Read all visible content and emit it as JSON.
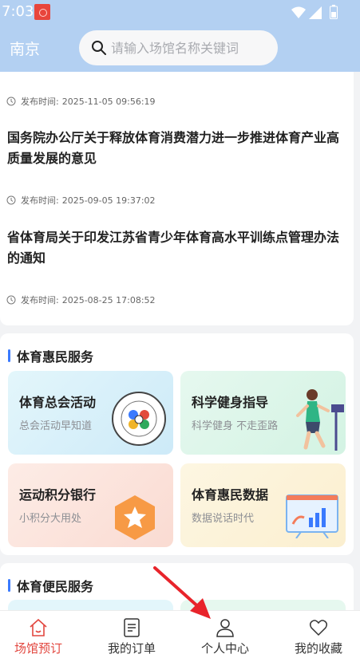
{
  "status": {
    "time": "7:03"
  },
  "header": {
    "city": "南京",
    "search_placeholder": "请输入场馆名称关键词"
  },
  "news": {
    "meta_label": "发布时间:",
    "items": [
      {
        "title": "",
        "time": "2025-11-05 09:56:19"
      },
      {
        "title": "国务院办公厅关于释放体育消费潜力进一步推进体育产业高质量发展的意见",
        "time": "2025-09-05 19:37:02"
      },
      {
        "title": "省体育局关于印发江苏省青少年体育高水平训练点管理办法的通知",
        "time": "2025-08-25 17:08:52"
      }
    ]
  },
  "services": {
    "title": "体育惠民服务",
    "items": [
      {
        "title": "体育总会活动",
        "subtitle": "总会活动早知道",
        "icon": "federation-logo",
        "bg": [
          "#dff5fb",
          "#d4eefa"
        ]
      },
      {
        "title": "科学健身指导",
        "subtitle": "科学健身 不走歪路",
        "icon": "runner-illustration",
        "bg": [
          "#e3f8ee",
          "#d5f4e6"
        ]
      },
      {
        "title": "运动积分银行",
        "subtitle": "小积分大用处",
        "icon": "star-hexagon-icon",
        "bg": [
          "#fde9e3",
          "#fbe0d8"
        ]
      },
      {
        "title": "体育惠民数据",
        "subtitle": "数据说话时代",
        "icon": "chart-board-icon",
        "bg": [
          "#fdf5df",
          "#fbf0d4"
        ]
      }
    ]
  },
  "convenience": {
    "title": "体育便民服务"
  },
  "tabs": [
    {
      "label": "场馆预订",
      "icon": "home-icon",
      "active": true
    },
    {
      "label": "我的订单",
      "icon": "order-icon",
      "active": false
    },
    {
      "label": "个人中心",
      "icon": "person-icon",
      "active": false
    },
    {
      "label": "我的收藏",
      "icon": "heart-icon",
      "active": false
    }
  ],
  "colors": {
    "accent": "#3a7afe",
    "active_tab": "#e2473f",
    "header": "#b3d0f2",
    "arrow": "#e8242b"
  }
}
